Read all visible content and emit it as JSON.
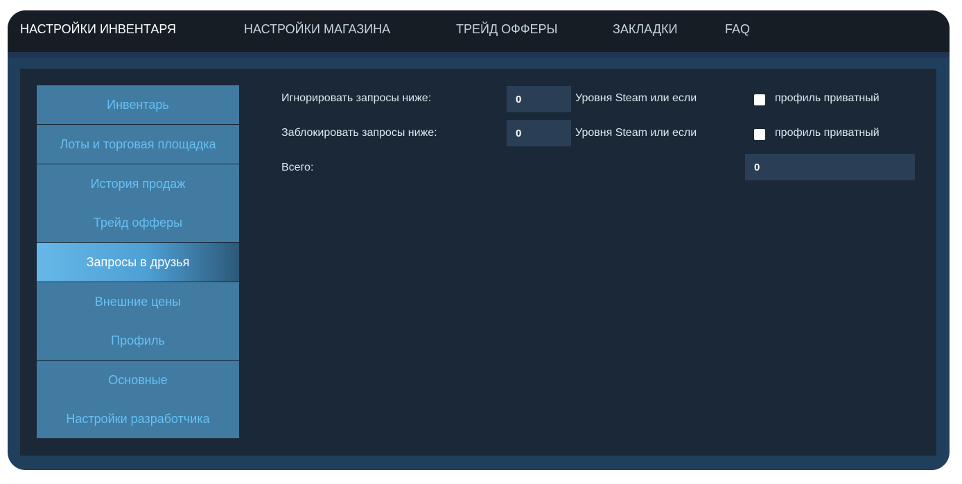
{
  "top_nav": {
    "tabs": [
      {
        "label": "НАСТРОЙКИ ИНВЕНТАРЯ",
        "active": true
      },
      {
        "label": "НАСТРОЙКИ МАГАЗИНА",
        "active": false
      },
      {
        "label": "ТРЕЙД ОФФЕРЫ",
        "active": false
      },
      {
        "label": "ЗАКЛАДКИ",
        "active": false
      },
      {
        "label": "FAQ",
        "active": false
      }
    ]
  },
  "sidebar": {
    "items": [
      {
        "label": "Инвентарь",
        "active": false
      },
      {
        "label": "Лоты и торговая площадка",
        "active": false
      },
      {
        "label": "История продаж",
        "active": false
      },
      {
        "label": "Трейд офферы",
        "active": false
      },
      {
        "label": "Запросы в друзья",
        "active": true
      },
      {
        "label": "Внешние цены",
        "active": false
      },
      {
        "label": "Профиль",
        "active": false
      },
      {
        "label": "Основные",
        "active": false
      },
      {
        "label": "Настройки разработчика",
        "active": false
      }
    ]
  },
  "friend_requests": {
    "ignore": {
      "label": "Игнорировать запросы ниже:",
      "value": "0",
      "suffix": "Уровня Steam или если",
      "checkbox_label": "профиль приватный",
      "checked": false
    },
    "block": {
      "label": "Заблокировать запросы ниже:",
      "value": "0",
      "suffix": "Уровня Steam или если",
      "checkbox_label": "профиль приватный",
      "checked": false
    },
    "total": {
      "label": "Всего:",
      "value": "0"
    }
  },
  "colors": {
    "nav_bg": "#171d25",
    "frame_bg": "#203f5c",
    "panel_bg": "#1b2838",
    "sidebar_item_bg": "#417ba1",
    "sidebar_item_text": "#66c0f4",
    "input_bg": "#2a3f55"
  }
}
